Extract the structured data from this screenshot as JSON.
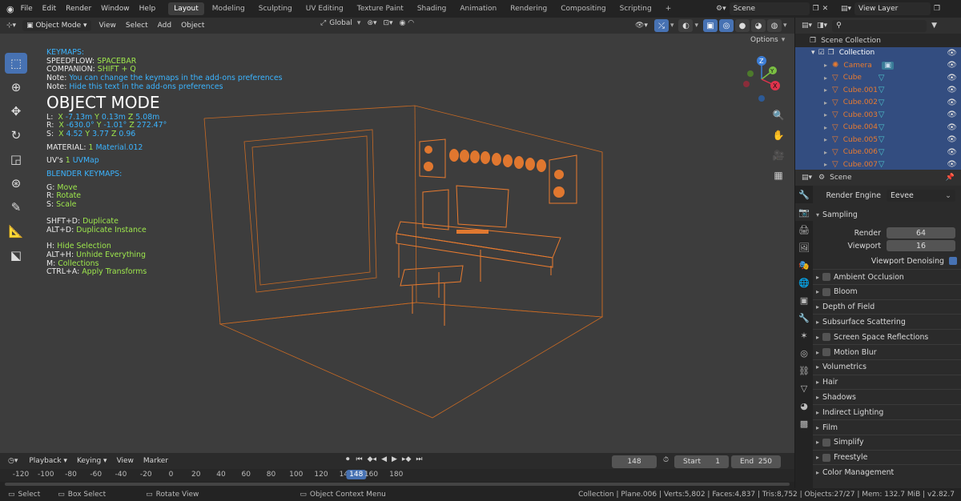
{
  "topbar": {
    "menus": [
      "File",
      "Edit",
      "Render",
      "Window",
      "Help"
    ],
    "workspaces": [
      "Layout",
      "Modeling",
      "Sculpting",
      "UV Editing",
      "Texture Paint",
      "Shading",
      "Animation",
      "Rendering",
      "Compositing",
      "Scripting"
    ],
    "active_workspace": "Layout",
    "add_tab": "+",
    "scene": "Scene",
    "view_layer": "View Layer"
  },
  "viewport": {
    "mode": "Object Mode",
    "menus": [
      "View",
      "Select",
      "Add",
      "Object"
    ],
    "transform_orientation": "Global",
    "options": "Options",
    "gizmo": {
      "z": "Z",
      "y": "Y",
      "x": "X"
    }
  },
  "overlay": {
    "keymaps_title": "KEYMAPS:",
    "speedflow_label": "SPEEDFLOW:",
    "speedflow_key": "SPACEBAR",
    "companion_label": "COMPANION:",
    "companion_key": "SHIFT + Q",
    "note_label": "Note:",
    "note1": "You can change the keymaps in the add-ons preferences",
    "note2": "Hide this text in the add-ons preferences",
    "mode_title": "OBJECT MODE",
    "loc_label": "L:",
    "loc_x_label": "X",
    "loc_x": "-7.13m",
    "loc_y_label": "Y",
    "loc_y": "0.13m",
    "loc_z_label": "Z",
    "loc_z": "5.08m",
    "rot_label": "R:",
    "rot_x_label": "X",
    "rot_x": "-630.0°",
    "rot_y_label": "Y",
    "rot_y": "-1.01°",
    "rot_z_label": "Z",
    "rot_z": "272.47°",
    "scl_label": "S:",
    "scl_x_label": "X",
    "scl_x": "4.52",
    "scl_y_label": "Y",
    "scl_y": "3.77",
    "scl_z_label": "Z",
    "scl_z": "0.96",
    "material_label": "MATERIAL:",
    "material_count": "1",
    "material_name": "Material.012",
    "uv_label": "UV's",
    "uv_count": "1",
    "uv_name": "UVMap",
    "blender_title": "BLENDER KEYMAPS:",
    "keymaps": [
      {
        "key": "G:",
        "action": "Move"
      },
      {
        "key": "R:",
        "action": "Rotate"
      },
      {
        "key": "S:",
        "action": "Scale"
      },
      {
        "key": "SHFT+D:",
        "action": "Duplicate"
      },
      {
        "key": "ALT+D:",
        "action": "Duplicate Instance"
      },
      {
        "key": "H:",
        "action": "Hide Selection"
      },
      {
        "key": "ALT+H:",
        "action": "Unhide Everything"
      },
      {
        "key": "M:",
        "action": "Collections"
      },
      {
        "key": "CTRL+A:",
        "action": "Apply Transforms"
      }
    ]
  },
  "timeline": {
    "menus": [
      "Playback",
      "Keying",
      "View",
      "Marker"
    ],
    "current_frame": "148",
    "start_label": "Start",
    "start": "1",
    "end_label": "End",
    "end": "250",
    "ticks": [
      "-120",
      "-100",
      "-80",
      "-60",
      "-40",
      "-20",
      "0",
      "20",
      "40",
      "60",
      "80",
      "100",
      "120",
      "140",
      "148",
      "160",
      "180"
    ],
    "tick_values": [
      -120,
      -100,
      -80,
      -60,
      -40,
      -20,
      0,
      20,
      40,
      60,
      80,
      100,
      120,
      140,
      148,
      160,
      180
    ]
  },
  "status": {
    "select": "Select",
    "box_select": "Box Select",
    "rotate_view": "Rotate View",
    "context_menu": "Object Context Menu",
    "stats": "Collection | Plane.006 | Verts:5,802 | Faces:4,837 | Tris:8,752 | Objects:27/27 | Mem: 132.7 MiB | v2.82.7"
  },
  "outliner": {
    "scene_collection": "Scene Collection",
    "collection": "Collection",
    "items": [
      "Camera",
      "Cube",
      "Cube.001",
      "Cube.002",
      "Cube.003",
      "Cube.004",
      "Cube.005",
      "Cube.006",
      "Cube.007"
    ]
  },
  "properties": {
    "context": "Scene",
    "render_engine_label": "Render Engine",
    "render_engine": "Eevee",
    "sampling": "Sampling",
    "render_label": "Render",
    "render_samples": "64",
    "viewport_label": "Viewport",
    "viewport_samples": "16",
    "viewport_denoising": "Viewport Denoising",
    "panels": [
      {
        "label": "Ambient Occlusion",
        "check": true
      },
      {
        "label": "Bloom",
        "check": true
      },
      {
        "label": "Depth of Field",
        "check": false
      },
      {
        "label": "Subsurface Scattering",
        "check": false
      },
      {
        "label": "Screen Space Reflections",
        "check": true
      },
      {
        "label": "Motion Blur",
        "check": true
      },
      {
        "label": "Volumetrics",
        "check": false
      },
      {
        "label": "Hair",
        "check": false
      },
      {
        "label": "Shadows",
        "check": false
      },
      {
        "label": "Indirect Lighting",
        "check": false
      },
      {
        "label": "Film",
        "check": false
      },
      {
        "label": "Simplify",
        "check": true
      },
      {
        "label": "Freestyle",
        "check": true
      },
      {
        "label": "Color Management",
        "check": false
      }
    ]
  },
  "colors": {
    "accent": "#4772b3",
    "selected_object": "#e97b2f",
    "overlay_blue": "#3bb4ff",
    "overlay_green": "#9ee84d",
    "viewport_bg": "#3d3d3d"
  }
}
